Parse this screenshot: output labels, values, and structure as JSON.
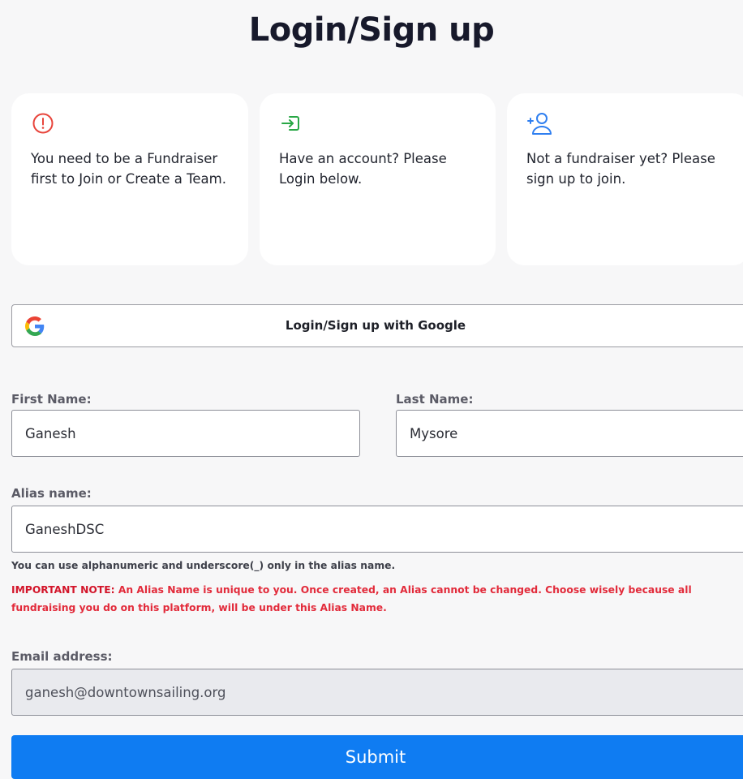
{
  "page": {
    "title": "Login/Sign up"
  },
  "cards": [
    {
      "icon": "alert-circle-icon",
      "text": "You need to be a Fundraiser first to Join or Create a Team."
    },
    {
      "icon": "login-arrow-icon",
      "text": "Have an account? Please Login below."
    },
    {
      "icon": "add-user-icon",
      "text": "Not a fundraiser yet? Please sign up to join."
    }
  ],
  "google": {
    "icon": "google-icon",
    "label": "Login/Sign up with Google"
  },
  "form": {
    "first_name": {
      "label": "First Name:",
      "value": "Ganesh"
    },
    "last_name": {
      "label": "Last Name:",
      "value": "Mysore"
    },
    "alias": {
      "label": "Alias name:",
      "value": "GaneshDSC"
    },
    "alias_hint": "You can use alphanumeric and underscore(_) only in the alias name.",
    "important_prefix": "IMPORTANT NOTE:",
    "important_text": " An Alias Name is unique to you. Once created, an Alias cannot be changed. Choose wisely because all fundraising you do on this platform, will be under this Alias Name.",
    "email": {
      "label": "Email address:",
      "value": "ganesh@downtownsailing.org"
    },
    "submit_label": "Submit"
  },
  "colors": {
    "accent": "#0f7cf2",
    "warning": "#e22a3a",
    "success_icon": "#28a745",
    "info_icon": "#2f7ff0"
  }
}
